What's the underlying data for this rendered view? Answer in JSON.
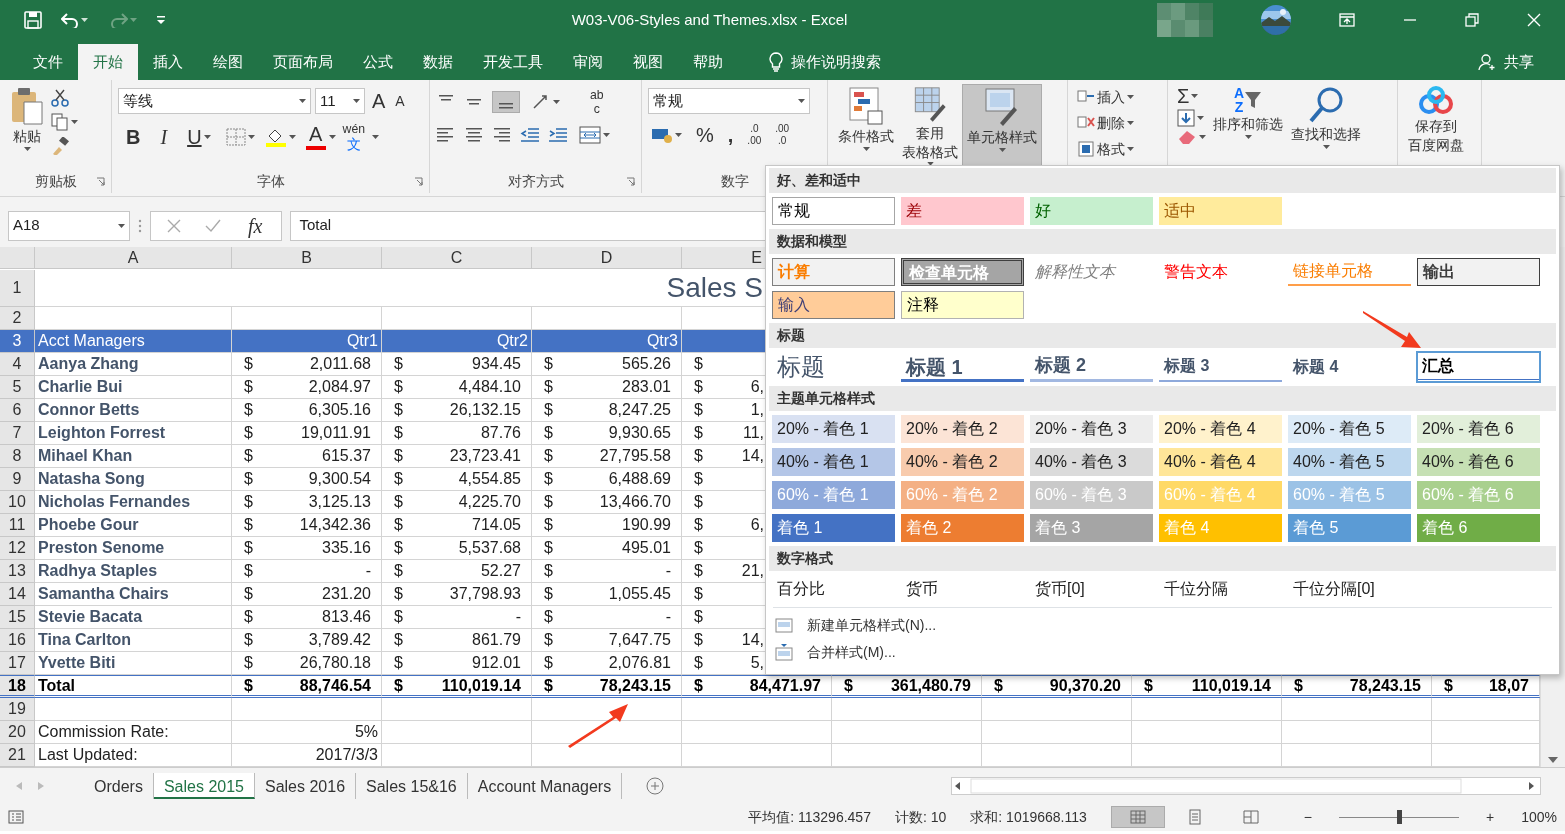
{
  "window": {
    "title": "W03-V06-Styles and Themes.xlsx  -  Excel"
  },
  "ribbon_tabs": [
    {
      "label": "文件",
      "selected": false
    },
    {
      "label": "开始",
      "selected": true
    },
    {
      "label": "插入",
      "selected": false
    },
    {
      "label": "绘图",
      "selected": false
    },
    {
      "label": "页面布局",
      "selected": false
    },
    {
      "label": "公式",
      "selected": false
    },
    {
      "label": "数据",
      "selected": false
    },
    {
      "label": "开发工具",
      "selected": false
    },
    {
      "label": "审阅",
      "selected": false
    },
    {
      "label": "视图",
      "selected": false
    },
    {
      "label": "帮助",
      "selected": false
    }
  ],
  "tell_me": {
    "label": "操作说明搜索"
  },
  "share": {
    "label": "共享"
  },
  "clipboard": {
    "paste": "粘贴",
    "group_label": "剪贴板"
  },
  "font": {
    "font_name": "等线",
    "font_size": "11",
    "grow": "A",
    "shrink": "A",
    "bold": "B",
    "italic": "I",
    "underline": "U",
    "font_color": "A",
    "phonetic_top": "wén",
    "phonetic_bottom": "文",
    "group_label": "字体"
  },
  "alignment": {
    "wrap_top": "ab",
    "wrap_bottom": "c",
    "group_label": "对齐方式"
  },
  "number": {
    "format": "常规",
    "percent": "%",
    "comma": ",",
    "increase_decimal": [
      ".0",
      ".00"
    ],
    "decrease_decimal": [
      ".00",
      ".0"
    ],
    "group_label": "数字"
  },
  "styles": {
    "conditional": "条件格式",
    "table_format": [
      "套用",
      "表格格式"
    ],
    "cell_styles": {
      "label": "单元格样式",
      "pressed": true
    }
  },
  "cells": [
    {
      "label": "插入"
    },
    {
      "label": "删除"
    },
    {
      "label": "格式"
    }
  ],
  "editing": {
    "sum": "Σ",
    "sort_letters": [
      "A",
      "Z"
    ],
    "sort_filter": "排序和筛选",
    "find_select": "查找和选择"
  },
  "baidu": {
    "label": [
      "保存到",
      "百度网盘"
    ]
  },
  "formula_bar": {
    "name_box": "A18",
    "fx": "fx",
    "value": "Total"
  },
  "sheet": {
    "columns": [
      "A",
      "B",
      "C",
      "D",
      "E"
    ],
    "rows": [
      {
        "number": "1",
        "kind": "title",
        "title": "Sales S"
      },
      {
        "number": "2",
        "kind": "blank"
      },
      {
        "number": "3",
        "kind": "header",
        "name": "Acct Managers",
        "cells": [
          {
            "val": "Qtr1"
          },
          {
            "val": "Qtr2"
          },
          {
            "val": "Qtr3"
          },
          {}
        ]
      },
      {
        "number": "4",
        "kind": "data",
        "name": "Aanya Zhang",
        "cells": [
          {
            "sym": "$",
            "val": "2,011.68"
          },
          {
            "sym": "$",
            "val": "934.45"
          },
          {
            "sym": "$",
            "val": "565.26"
          },
          {
            "sym": "$"
          }
        ]
      },
      {
        "number": "5",
        "kind": "data",
        "name": "Charlie Bui",
        "cells": [
          {
            "sym": "$",
            "val": "2,084.97"
          },
          {
            "sym": "$",
            "val": "4,484.10"
          },
          {
            "sym": "$",
            "val": "283.01"
          },
          {
            "sym": "$",
            "val": "6,"
          }
        ]
      },
      {
        "number": "6",
        "kind": "data",
        "name": "Connor Betts",
        "cells": [
          {
            "sym": "$",
            "val": "6,305.16"
          },
          {
            "sym": "$",
            "val": "26,132.15"
          },
          {
            "sym": "$",
            "val": "8,247.25"
          },
          {
            "sym": "$",
            "val": "1,"
          }
        ]
      },
      {
        "number": "7",
        "kind": "data",
        "name": "Leighton Forrest",
        "cells": [
          {
            "sym": "$",
            "val": "19,011.91"
          },
          {
            "sym": "$",
            "val": "87.76"
          },
          {
            "sym": "$",
            "val": "9,930.65"
          },
          {
            "sym": "$",
            "val": "11,"
          }
        ]
      },
      {
        "number": "8",
        "kind": "data",
        "name": "Mihael Khan",
        "cells": [
          {
            "sym": "$",
            "val": "615.37"
          },
          {
            "sym": "$",
            "val": "23,723.41"
          },
          {
            "sym": "$",
            "val": "27,795.58"
          },
          {
            "sym": "$",
            "val": "14,"
          }
        ]
      },
      {
        "number": "9",
        "kind": "data",
        "name": "Natasha Song",
        "cells": [
          {
            "sym": "$",
            "val": "9,300.54"
          },
          {
            "sym": "$",
            "val": "4,554.85"
          },
          {
            "sym": "$",
            "val": "6,488.69"
          },
          {
            "sym": "$"
          }
        ]
      },
      {
        "number": "10",
        "kind": "data",
        "name": "Nicholas Fernandes",
        "cells": [
          {
            "sym": "$",
            "val": "3,125.13"
          },
          {
            "sym": "$",
            "val": "4,225.70"
          },
          {
            "sym": "$",
            "val": "13,466.70"
          },
          {
            "sym": "$"
          }
        ]
      },
      {
        "number": "11",
        "kind": "data",
        "name": "Phoebe Gour",
        "cells": [
          {
            "sym": "$",
            "val": "14,342.36"
          },
          {
            "sym": "$",
            "val": "714.05"
          },
          {
            "sym": "$",
            "val": "190.99"
          },
          {
            "sym": "$",
            "val": "6,"
          }
        ]
      },
      {
        "number": "12",
        "kind": "data",
        "name": "Preston Senome",
        "cells": [
          {
            "sym": "$",
            "val": "335.16"
          },
          {
            "sym": "$",
            "val": "5,537.68"
          },
          {
            "sym": "$",
            "val": "495.01"
          },
          {
            "sym": "$"
          }
        ]
      },
      {
        "number": "13",
        "kind": "data",
        "name": "Radhya Staples",
        "cells": [
          {
            "sym": "$",
            "val": "-"
          },
          {
            "sym": "$",
            "val": "52.27"
          },
          {
            "sym": "$",
            "val": "-"
          },
          {
            "sym": "$",
            "val": "21,"
          }
        ]
      },
      {
        "number": "14",
        "kind": "data",
        "name": "Samantha Chairs",
        "cells": [
          {
            "sym": "$",
            "val": "231.20"
          },
          {
            "sym": "$",
            "val": "37,798.93"
          },
          {
            "sym": "$",
            "val": "1,055.45"
          },
          {
            "sym": "$"
          }
        ]
      },
      {
        "number": "15",
        "kind": "data",
        "name": "Stevie Bacata",
        "cells": [
          {
            "sym": "$",
            "val": "813.46"
          },
          {
            "sym": "$",
            "val": "-"
          },
          {
            "sym": "$",
            "val": "-"
          },
          {
            "sym": "$"
          }
        ]
      },
      {
        "number": "16",
        "kind": "data",
        "name": "Tina Carlton",
        "cells": [
          {
            "sym": "$",
            "val": "3,789.42"
          },
          {
            "sym": "$",
            "val": "861.79"
          },
          {
            "sym": "$",
            "val": "7,647.75"
          },
          {
            "sym": "$",
            "val": "14,"
          }
        ]
      },
      {
        "number": "17",
        "kind": "data",
        "name": "Yvette Biti",
        "cells": [
          {
            "sym": "$",
            "val": "26,780.18"
          },
          {
            "sym": "$",
            "val": "912.01"
          },
          {
            "sym": "$",
            "val": "2,076.81"
          },
          {
            "sym": "$",
            "val": "5,"
          }
        ]
      },
      {
        "number": "18",
        "kind": "total",
        "name": "Total",
        "cells": [
          {
            "sym": "$",
            "val": "88,746.54"
          },
          {
            "sym": "$",
            "val": "110,019.14"
          },
          {
            "sym": "$",
            "val": "78,243.15"
          },
          {
            "sym": "$",
            "val": "84,471.97"
          },
          {
            "sym": "$",
            "val": "361,480.79"
          },
          {
            "sym": "$",
            "val": "90,370.20"
          },
          {
            "sym": "$",
            "val": "110,019.14"
          },
          {
            "sym": "$",
            "val": "78,243.15"
          },
          {
            "sym": "$",
            "val": "18,07"
          }
        ]
      },
      {
        "number": "19",
        "kind": "blank"
      },
      {
        "number": "20",
        "kind": "label",
        "name": "Commission Rate:",
        "cells": [
          {
            "val": "5%"
          }
        ]
      },
      {
        "number": "21",
        "kind": "label",
        "name": "Last Updated:",
        "cells": [
          {
            "val": "2017/3/3"
          }
        ]
      }
    ]
  },
  "gallery": {
    "sections": [
      {
        "title": "好、差和适中",
        "items": [
          {
            "label": "常规",
            "kind": "normal",
            "selected": false
          },
          {
            "label": "差",
            "kind": "bad",
            "selected": false
          },
          {
            "label": "好",
            "kind": "good",
            "selected": false
          },
          {
            "label": "适中",
            "kind": "neutral",
            "selected": false
          }
        ]
      },
      {
        "title": "数据和模型",
        "items": [
          {
            "label": "计算",
            "kind": "calculation",
            "selected": false
          },
          {
            "label": "检查单元格",
            "kind": "check",
            "selected": false
          },
          {
            "label": "解释性文本",
            "kind": "explanatory",
            "selected": false
          },
          {
            "label": "警告文本",
            "kind": "warning",
            "selected": false
          },
          {
            "label": "链接单元格",
            "kind": "linked",
            "selected": false
          },
          {
            "label": "输出",
            "kind": "output",
            "selected": false
          },
          {
            "label": "输入",
            "kind": "input",
            "selected": false
          },
          {
            "label": "注释",
            "kind": "note",
            "selected": false
          }
        ]
      },
      {
        "title": "标题",
        "items": [
          {
            "label": "标题",
            "kind": "title",
            "selected": false
          },
          {
            "label": "标题 1",
            "kind": "heading1",
            "selected": false
          },
          {
            "label": "标题 2",
            "kind": "heading2",
            "selected": false
          },
          {
            "label": "标题 3",
            "kind": "heading3",
            "selected": false
          },
          {
            "label": "标题 4",
            "kind": "heading4",
            "selected": false
          },
          {
            "label": "汇总",
            "kind": "total",
            "selected": true
          }
        ]
      },
      {
        "title": "主题单元格样式",
        "items": [
          {
            "label": "20% - 着色 1",
            "kind": "tint",
            "color": "#d9e1f2",
            "selected": false
          },
          {
            "label": "20% - 着色 2",
            "kind": "tint",
            "color": "#fce4d6",
            "selected": false
          },
          {
            "label": "20% - 着色 3",
            "kind": "tint",
            "color": "#ededed",
            "selected": false
          },
          {
            "label": "20% - 着色 4",
            "kind": "tint",
            "color": "#fff2cc",
            "selected": false
          },
          {
            "label": "20% - 着色 5",
            "kind": "tint",
            "color": "#ddebf7",
            "selected": false
          },
          {
            "label": "20% - 着色 6",
            "kind": "tint",
            "color": "#e2efda",
            "selected": false
          },
          {
            "label": "40% - 着色 1",
            "kind": "tint",
            "color": "#b4c6e7",
            "selected": false
          },
          {
            "label": "40% - 着色 2",
            "kind": "tint",
            "color": "#f8cbad",
            "selected": false
          },
          {
            "label": "40% - 着色 3",
            "kind": "tint",
            "color": "#dbdbdb",
            "selected": false
          },
          {
            "label": "40% - 着色 4",
            "kind": "tint",
            "color": "#ffe699",
            "selected": false
          },
          {
            "label": "40% - 着色 5",
            "kind": "tint",
            "color": "#bdd7ee",
            "selected": false
          },
          {
            "label": "40% - 着色 6",
            "kind": "tint",
            "color": "#c6e0b4",
            "selected": false
          },
          {
            "label": "60% - 着色 1",
            "kind": "accent",
            "color": "#8ea9db",
            "selected": false
          },
          {
            "label": "60% - 着色 2",
            "kind": "accent",
            "color": "#f4b084",
            "selected": false
          },
          {
            "label": "60% - 着色 3",
            "kind": "accent",
            "color": "#c9c9c9",
            "selected": false
          },
          {
            "label": "60% - 着色 4",
            "kind": "accent",
            "color": "#ffd966",
            "selected": false
          },
          {
            "label": "60% - 着色 5",
            "kind": "accent",
            "color": "#9bc2e6",
            "selected": false
          },
          {
            "label": "60% - 着色 6",
            "kind": "accent",
            "color": "#a9d08e",
            "selected": false
          },
          {
            "label": "着色 1",
            "kind": "accent",
            "color": "#4472c4",
            "selected": false
          },
          {
            "label": "着色 2",
            "kind": "accent",
            "color": "#ed7d31",
            "selected": false
          },
          {
            "label": "着色 3",
            "kind": "accent",
            "color": "#a5a5a5",
            "selected": false
          },
          {
            "label": "着色 4",
            "kind": "accent",
            "color": "#ffc000",
            "selected": false
          },
          {
            "label": "着色 5",
            "kind": "accent",
            "color": "#5b9bd5",
            "selected": false
          },
          {
            "label": "着色 6",
            "kind": "accent",
            "color": "#70ad47",
            "selected": false
          }
        ]
      },
      {
        "title": "数字格式",
        "items": [
          {
            "label": "百分比",
            "kind": "plain",
            "selected": false
          },
          {
            "label": "货币",
            "kind": "plain",
            "selected": false
          },
          {
            "label": "货币[0]",
            "kind": "plain",
            "selected": false
          },
          {
            "label": "千位分隔",
            "kind": "plain",
            "selected": false
          },
          {
            "label": "千位分隔[0]",
            "kind": "plain",
            "selected": false
          }
        ]
      }
    ],
    "commands": [
      {
        "label": "新建单元格样式(N)..."
      },
      {
        "label": "合并样式(M)..."
      }
    ]
  },
  "sheet_tabs": [
    {
      "label": "Orders",
      "selected": false
    },
    {
      "label": "Sales 2015",
      "selected": true
    },
    {
      "label": "Sales 2016",
      "selected": false
    },
    {
      "label": "Sales 15&16",
      "selected": false
    },
    {
      "label": "Account Managers",
      "selected": false
    }
  ],
  "status_bar": {
    "average": "平均值: 113296.457",
    "count": "计数: 10",
    "sum": "求和: 1019668.113",
    "views": [
      {
        "selected": true
      },
      {
        "selected": false
      },
      {
        "selected": false
      }
    ],
    "zoom_out": "−",
    "zoom_slider": {
      "level": 0.5
    },
    "zoom_in": "+",
    "zoom": "100%"
  }
}
